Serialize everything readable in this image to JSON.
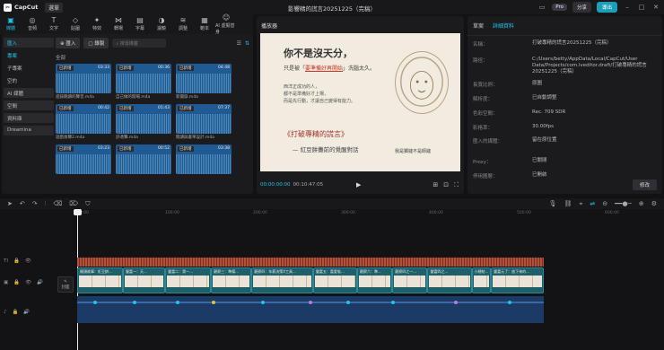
{
  "titlebar": {
    "app_name": "CapCut",
    "menu": "選單",
    "title": "影響精的謊言20251225（完稿）",
    "pro": "Pro",
    "share": "分享",
    "export": "導出"
  },
  "toolbar": {
    "items": [
      {
        "label": "媒體",
        "icon": "▣"
      },
      {
        "label": "音頻",
        "icon": "◎"
      },
      {
        "label": "文字",
        "icon": "T"
      },
      {
        "label": "貼圖",
        "icon": "◇"
      },
      {
        "label": "特效",
        "icon": "✦"
      },
      {
        "label": "轉場",
        "icon": "⋈"
      },
      {
        "label": "字幕",
        "icon": "▤"
      },
      {
        "label": "濾鏡",
        "icon": "◑"
      },
      {
        "label": "調整",
        "icon": "≋"
      },
      {
        "label": "範本",
        "icon": "▦"
      },
      {
        "label": "AI 虛擬替身",
        "icon": "☺"
      }
    ]
  },
  "media": {
    "sidebar": [
      "匯入",
      "專案",
      "子專案",
      "空的",
      "AI 媒體",
      "空間",
      "資料庫",
      "Dreamina"
    ],
    "import_button": "匯入",
    "record_button": "錄製",
    "search_placeholder": "搜尋媒體",
    "all_label": "全部",
    "items": [
      {
        "badge": "已新增",
        "duration": "03:33",
        "name": "進錄朗讀的聲音.m4a"
      },
      {
        "badge": "已新增",
        "duration": "00:36",
        "name": "自己做的開場.m4a"
      },
      {
        "badge": "已新增",
        "duration": "04:48",
        "name": "新聞錄.m4a"
      },
      {
        "badge": "已新增",
        "duration": "00:42",
        "name": "遊戲後聲2.m4a"
      },
      {
        "badge": "已新增",
        "duration": "01:43",
        "name": "舒適聲.m4a"
      },
      {
        "badge": "已新增",
        "duration": "07:37",
        "name": "閱讀與書單設計.m4a"
      },
      {
        "badge": "已新增",
        "duration": "03:23",
        "name": ""
      },
      {
        "badge": "已新增",
        "duration": "00:52",
        "name": ""
      },
      {
        "badge": "已新增",
        "duration": "03:38",
        "name": ""
      }
    ]
  },
  "player": {
    "title": "播放器",
    "timecode": "00:00:00:00",
    "total": "00:10:47:05",
    "slide": {
      "heading": "你不是沒天分，",
      "line2_pre": "只是被「",
      "line2_hl": "要準備好再開始",
      "line2_post": "」洗腦太久。",
      "small1": "西洋正成功的人，",
      "small2": "都不是準備好才上場，",
      "small3": "而是先行動，才讓自己變得有能力。",
      "book": "《打破專精的謊言》",
      "byline": "— 紅豆餅攤前的覺醒對話",
      "caption": "我是獅鏈不是師鏈"
    }
  },
  "details": {
    "tabs": [
      "草案",
      "詳細資料"
    ],
    "rows": [
      {
        "label": "名稱：",
        "value": "打破專精的謊言20251225（完稿）"
      },
      {
        "label": "路徑：",
        "value": "C:/Users/betty/AppData/Local/CapCut/User Data/Projects/com.lveditor.draft/打破專精的謊言20251225（完稿）"
      },
      {
        "label": "長寬比例：",
        "value": "原圖"
      },
      {
        "label": "解析度：",
        "value": "已自動調整"
      },
      {
        "label": "色彩空間：",
        "value": "Rec. 709 SDR"
      },
      {
        "label": "影格率：",
        "value": "30.00fps"
      },
      {
        "label": "匯入的媒體：",
        "value": "留在原位置"
      },
      {
        "label": "Proxy：",
        "value": "已關閉"
      },
      {
        "label": "停用圖層：",
        "value": "已開啟"
      }
    ],
    "modify_button": "修改"
  },
  "timeline": {
    "ruler": [
      "00:00",
      "100:00",
      "200:00",
      "300:00",
      "400:00",
      "500:00",
      "600:00"
    ],
    "cover_label": "封面",
    "clips": [
      {
        "title": "開頭故事：紅豆餅..."
      },
      {
        "title": "豐富一：天..."
      },
      {
        "title": "豐富二：第一..."
      },
      {
        "title": "觀察三：準備..."
      },
      {
        "title": "觀察四：年薪決策X工具..."
      },
      {
        "title": "豐富五：喜愛吸..."
      },
      {
        "title": "觀察六：準..."
      },
      {
        "title": "觀察四之一..."
      },
      {
        "title": "豐富四之..."
      },
      {
        "title": "小總結..."
      },
      {
        "title": "豐富元了：放下來的..."
      }
    ]
  },
  "colors": {
    "accent": "#22c3e6",
    "audio": "#1c3a66",
    "video": "#1f5f6a",
    "text_track": "#b2513a"
  }
}
